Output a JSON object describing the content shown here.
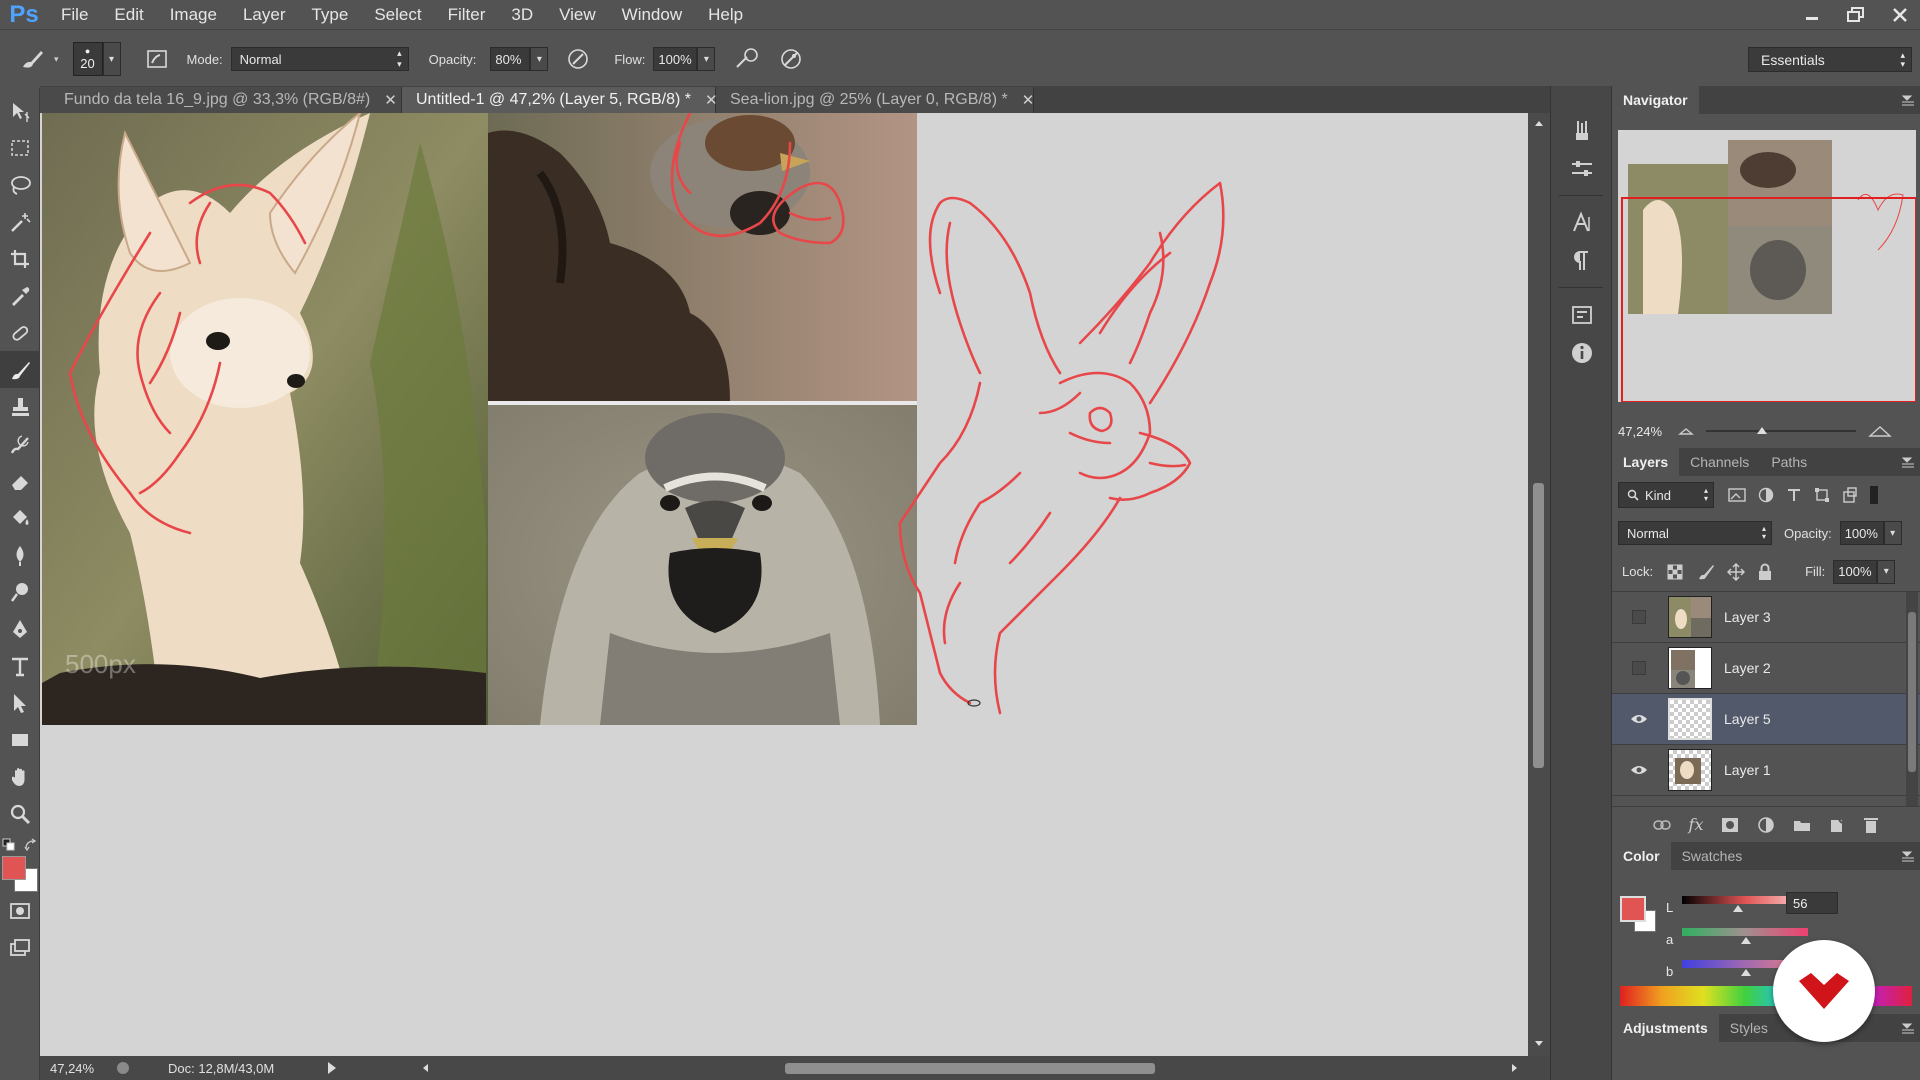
{
  "app": {
    "logo": "Ps"
  },
  "menu": [
    "File",
    "Edit",
    "Image",
    "Layer",
    "Type",
    "Select",
    "Filter",
    "3D",
    "View",
    "Window",
    "Help"
  ],
  "options": {
    "brush_size": "20",
    "mode_label": "Mode:",
    "mode_value": "Normal",
    "opacity_label": "Opacity:",
    "opacity_value": "80%",
    "flow_label": "Flow:",
    "flow_value": "100%",
    "workspace": "Essentials"
  },
  "tabs": [
    {
      "label": "Fundo da tela 16_9.jpg @ 33,3% (RGB/8#)",
      "active": false
    },
    {
      "label": "Untitled-1 @ 47,2% (Layer 5, RGB/8) *",
      "active": true
    },
    {
      "label": "Sea-lion.jpg @ 25% (Layer 0, RGB/8) *",
      "active": false
    }
  ],
  "status": {
    "zoom": "47,24%",
    "doc": "Doc: 12,8M/43,0M"
  },
  "watermark": "500px",
  "navigator": {
    "title": "Navigator",
    "zoom": "47,24%"
  },
  "layers_panel": {
    "tabs": [
      "Layers",
      "Channels",
      "Paths"
    ],
    "filter_kind": "Kind",
    "blend_mode": "Normal",
    "opacity_label": "Opacity:",
    "opacity_value": "100%",
    "lock_label": "Lock:",
    "fill_label": "Fill:",
    "fill_value": "100%",
    "layers": [
      {
        "name": "Layer 3",
        "visible": false,
        "selected": false
      },
      {
        "name": "Layer 2",
        "visible": false,
        "selected": false
      },
      {
        "name": "Layer 5",
        "visible": true,
        "selected": true
      },
      {
        "name": "Layer 1",
        "visible": true,
        "selected": false
      }
    ]
  },
  "color_panel": {
    "tabs": [
      "Color",
      "Swatches"
    ],
    "channel_L": "L",
    "channel_a": "a",
    "channel_b": "b",
    "L_value": "56",
    "foreground": "#e05454",
    "background": "#ffffff"
  },
  "adjustments_panel": {
    "tabs": [
      "Adjustments",
      "Styles"
    ]
  },
  "colors": {
    "accent": "#e05454",
    "sketch_stroke": "#e8474a",
    "canvas": "#d4d4d4"
  }
}
